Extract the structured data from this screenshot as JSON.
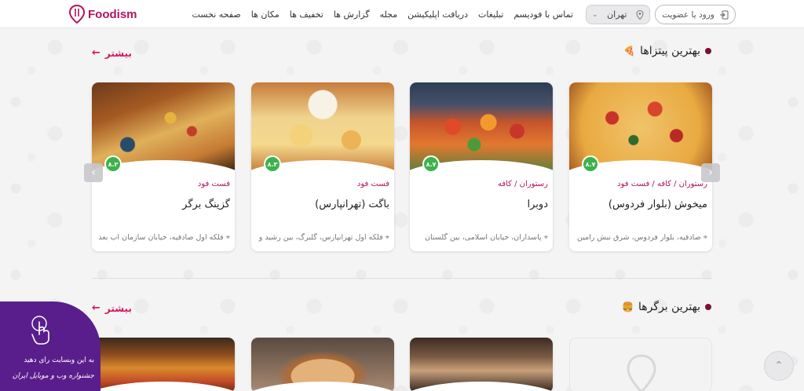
{
  "header": {
    "logo_text": "Foodism",
    "login_label": "ورود یا عضویت",
    "city": "تهران",
    "nav": [
      "صفحه نخست",
      "مکان ها",
      "تخفیف ها",
      "گزارش ها",
      "مجله",
      "دریافت اپلیکیشن",
      "تبلیغات",
      "تماس با فودیسم"
    ]
  },
  "sections": [
    {
      "title": "بهترین پیتزاها",
      "emoji": "🍕",
      "more_label": "بیشتر",
      "cards": [
        {
          "rating": "۸.۷",
          "category": "رستوران / کافه / فست فود",
          "name": "میخوش (بلوار فردوس)",
          "address": "صادقیه، بلوار فردوس، شرق نبش رامین"
        },
        {
          "rating": "۸.۷",
          "category": "رستوران / کافه",
          "name": "دوبرا",
          "address": "پاسداران، خیابان اسلامی، بین گلستان"
        },
        {
          "rating": "۸.۳",
          "category": "فست فود",
          "name": "باگت (تهرانپارس)",
          "address": "فلکه اول تهرانپارس، گلبرگ، بین رشید و"
        },
        {
          "rating": "۸.۲",
          "category": "فست فود",
          "name": "گزینگ برگر",
          "address": "فلکه اول صادقیه، خیابان سازمان آب بعد"
        }
      ]
    },
    {
      "title": "بهترین برگرها",
      "emoji": "🍔",
      "more_label": "بیشتر"
    }
  ],
  "promo": {
    "line1": "به این وبسایت رای دهید",
    "line2": "جشنواره وب و موبایل ایران"
  },
  "icons": {
    "login": "login-icon",
    "location": "location-pin-icon",
    "chevron": "chevron-down-icon",
    "scroll_top": "chevron-up-icon"
  },
  "colors": {
    "brand": "#b0155c",
    "rating": "#3cb34a",
    "promo": "#5a1e8c"
  }
}
